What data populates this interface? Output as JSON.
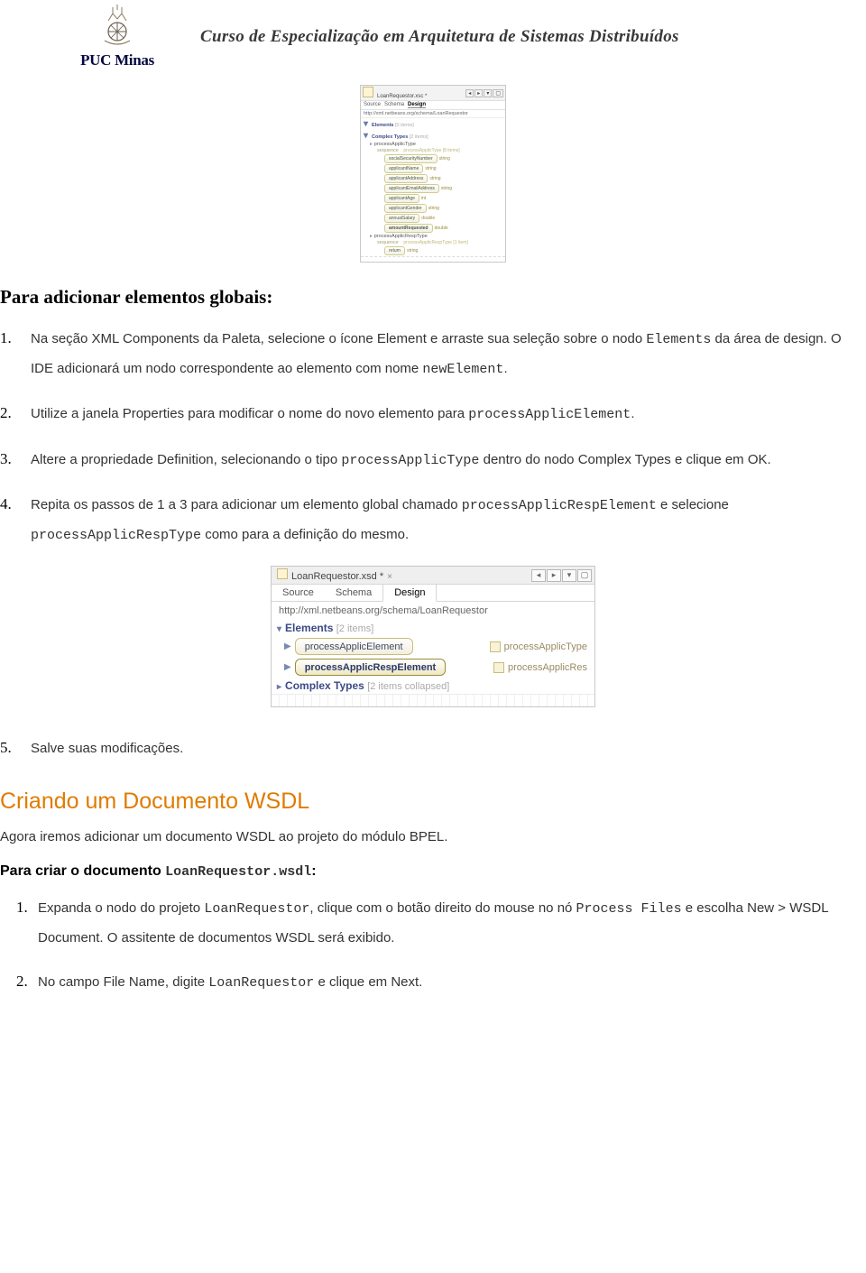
{
  "header": {
    "logo_text": "PUC Minas",
    "course_title": "Curso de Especialização em Arquitetura de Sistemas Distribuídos"
  },
  "ide_mini": {
    "filename": "LoanRequestor.xsc *",
    "tabs": {
      "source": "Source",
      "schema": "Schema",
      "design": "Design"
    },
    "url": "http://xml.netbeans.org/schema/LoanRequestor",
    "sections": {
      "elements": {
        "label": "Elements",
        "count": "[0 items]"
      },
      "complex_types": {
        "label": "Complex Types",
        "count": "[2 items]"
      }
    },
    "row_applic_type": "processApplicType",
    "row_sequence": {
      "label": "sequence",
      "items": "processApplicType  [8 items]"
    },
    "fields": [
      {
        "name": "socialSecurityNumber",
        "type": "string"
      },
      {
        "name": "applicantName",
        "type": "string"
      },
      {
        "name": "applicantAddress",
        "type": "string"
      },
      {
        "name": "applicantEmailAddress",
        "type": "string"
      },
      {
        "name": "applicantAge",
        "type": "int"
      },
      {
        "name": "applicantGender",
        "type": "string"
      },
      {
        "name": "annualSalary",
        "type": "double"
      },
      {
        "name": "amountRequested",
        "type": "double"
      }
    ],
    "row_resp_type": "processApplicRespType",
    "row_resp_sequence": {
      "label": "sequence",
      "items": "processApplicRespType  [1 item]"
    },
    "resp_field": {
      "name": "return",
      "type": "string"
    }
  },
  "section1": {
    "title": "Para adicionar elementos globais:",
    "steps": {
      "1": {
        "pre": "Na seção XML Components da Paleta, selecione o ícone Element e arraste sua seleção sobre o nodo ",
        "mono1": "Elements",
        "mid": " da área de design. O IDE adicionará um nodo correspondente ao elemento com nome ",
        "mono2": "newElement",
        "post": "."
      },
      "2": {
        "pre": "Utilize a janela Properties para modificar o nome do novo elemento para ",
        "mono": "processApplicElement",
        "post": "."
      },
      "3": {
        "pre": "Altere a propriedade Definition, selecionando o tipo ",
        "mono": "processApplicType",
        "post": " dentro do nodo Complex Types e clique em OK."
      },
      "4": {
        "pre": "Repita os passos de 1 a 3 para adicionar um elemento global chamado ",
        "mono1": "processApplicRespElement",
        "mid": " e selecione ",
        "mono2": "processApplicRespType",
        "post": " como para a definição do mesmo."
      },
      "5": "Salve suas modificações."
    }
  },
  "ide_large": {
    "filename": "LoanRequestor.xsd *",
    "tabs": {
      "source": "Source",
      "schema": "Schema",
      "design": "Design"
    },
    "url": "http://xml.netbeans.org/schema/LoanRequestor",
    "elements_label": "Elements",
    "elements_count": "[2 items]",
    "row1": {
      "name": "processApplicElement",
      "type": "processApplicType"
    },
    "row2": {
      "name": "processApplicRespElement",
      "type": "processApplicRes"
    },
    "complex_label": "Complex Types",
    "complex_count": "[2 items collapsed]"
  },
  "section2": {
    "title": "Criando um Documento WSDL",
    "intro": "Agora iremos adicionar um documento WSDL ao projeto do módulo BPEL.",
    "subtitle_pre": "Para criar o documento ",
    "subtitle_mono": "LoanRequestor.wsdl",
    "subtitle_post": ":",
    "steps": {
      "1": {
        "pre": "Expanda o nodo do projeto ",
        "mono1": "LoanRequestor",
        "mid": ", clique com o botão direito do mouse no nó ",
        "mono2": "Process Files",
        "post": " e escolha New > WSDL Document. O assitente de documentos WSDL será exibido."
      },
      "2": {
        "pre": "No campo File Name, digite ",
        "mono": "LoanRequestor",
        "post": " e clique em Next."
      }
    }
  }
}
